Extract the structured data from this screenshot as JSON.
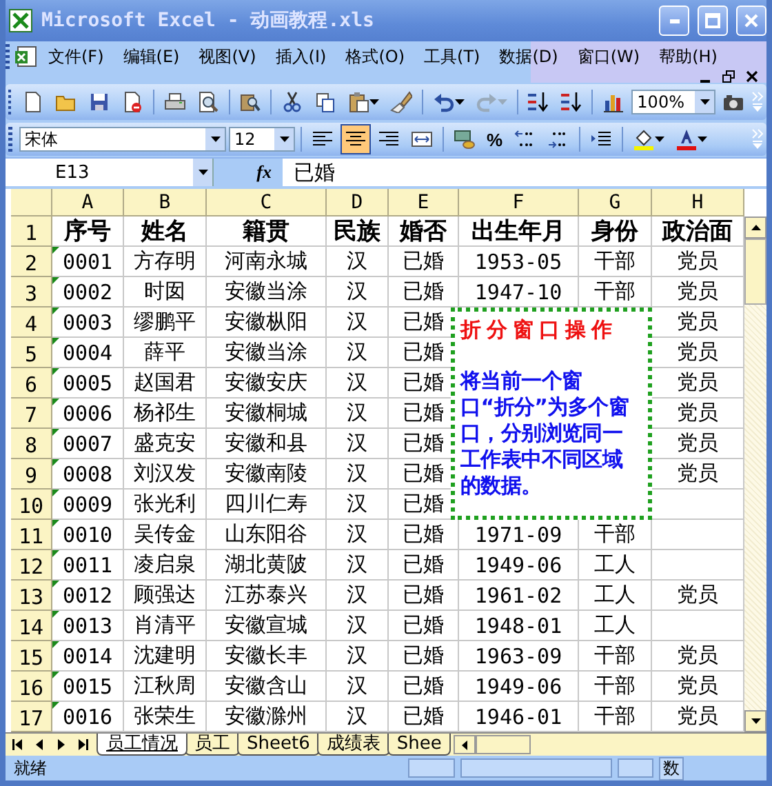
{
  "window": {
    "title": "Microsoft Excel - 动画教程.xls"
  },
  "menu": [
    "文件(F)",
    "编辑(E)",
    "视图(V)",
    "插入(I)",
    "格式(O)",
    "工具(T)",
    "数据(D)",
    "窗口(W)",
    "帮助(H)"
  ],
  "standard_toolbar": {
    "zoom": "100%"
  },
  "format_toolbar": {
    "font": "宋体",
    "size": "12",
    "percent": "%",
    "alignment": [
      {
        "kind": "left",
        "selected": false
      },
      {
        "kind": "center",
        "selected": true
      },
      {
        "kind": "right",
        "selected": false
      }
    ]
  },
  "formula_bar": {
    "name_box": "E13",
    "fx": "fx",
    "value": "已婚"
  },
  "sheet": {
    "columns": [
      "A",
      "B",
      "C",
      "D",
      "E",
      "F",
      "G",
      "H"
    ],
    "rows": [
      {
        "number": "1",
        "kind": "heading",
        "flagged": false,
        "cells": [
          "序号",
          "姓名",
          "籍贯",
          "民族",
          "婚否",
          "出生年月",
          "身份",
          "政治面"
        ]
      },
      {
        "number": "2",
        "kind": "data",
        "flagged": true,
        "cells": [
          "0001",
          "方存明",
          "河南永城",
          "汉",
          "已婚",
          "1953-05",
          "干部",
          "党员"
        ]
      },
      {
        "number": "3",
        "kind": "data",
        "flagged": true,
        "cells": [
          "0002",
          "时囡",
          "安徽当涂",
          "汉",
          "已婚",
          "1947-10",
          "干部",
          "党员"
        ]
      },
      {
        "number": "4",
        "kind": "data",
        "flagged": true,
        "cells": [
          "0003",
          "缪鹏平",
          "安徽枞阳",
          "汉",
          "已婚",
          null,
          null,
          "党员"
        ]
      },
      {
        "number": "5",
        "kind": "data",
        "flagged": true,
        "cells": [
          "0004",
          "薛平",
          "安徽当涂",
          "汉",
          "已婚",
          null,
          null,
          "党员"
        ]
      },
      {
        "number": "6",
        "kind": "data",
        "flagged": true,
        "cells": [
          "0005",
          "赵国君",
          "安徽安庆",
          "汉",
          "已婚",
          null,
          null,
          "党员"
        ]
      },
      {
        "number": "7",
        "kind": "data",
        "flagged": true,
        "cells": [
          "0006",
          "杨祁生",
          "安徽桐城",
          "汉",
          "已婚",
          null,
          null,
          "党员"
        ]
      },
      {
        "number": "8",
        "kind": "data",
        "flagged": true,
        "cells": [
          "0007",
          "盛克安",
          "安徽和县",
          "汉",
          "已婚",
          null,
          null,
          "党员"
        ]
      },
      {
        "number": "9",
        "kind": "data",
        "flagged": true,
        "cells": [
          "0008",
          "刘汉发",
          "安徽南陵",
          "汉",
          "已婚",
          null,
          null,
          "党员"
        ]
      },
      {
        "number": "10",
        "kind": "data",
        "flagged": true,
        "cells": [
          "0009",
          "张光利",
          "四川仁寿",
          "汉",
          "已婚",
          null,
          null,
          null
        ]
      },
      {
        "number": "11",
        "kind": "data",
        "flagged": true,
        "cells": [
          "0010",
          "吴传金",
          "山东阳谷",
          "汉",
          "已婚",
          "1971-09",
          "干部",
          null
        ]
      },
      {
        "number": "12",
        "kind": "data",
        "flagged": true,
        "cells": [
          "0011",
          "凌启泉",
          "湖北黄陂",
          "汉",
          "已婚",
          "1949-06",
          "工人",
          null
        ]
      },
      {
        "number": "13",
        "kind": "data",
        "flagged": true,
        "cells": [
          "0012",
          "顾强达",
          "江苏泰兴",
          "汉",
          "已婚",
          "1961-02",
          "工人",
          "党员"
        ]
      },
      {
        "number": "14",
        "kind": "data",
        "flagged": true,
        "cells": [
          "0013",
          "肖清平",
          "安徽宣城",
          "汉",
          "已婚",
          "1948-01",
          "工人",
          null
        ]
      },
      {
        "number": "15",
        "kind": "data",
        "flagged": true,
        "cells": [
          "0014",
          "沈建明",
          "安徽长丰",
          "汉",
          "已婚",
          "1963-09",
          "干部",
          "党员"
        ]
      },
      {
        "number": "16",
        "kind": "data",
        "flagged": true,
        "cells": [
          "0015",
          "江秋周",
          "安徽含山",
          "汉",
          "已婚",
          "1949-06",
          "干部",
          "党员"
        ]
      },
      {
        "number": "17",
        "kind": "data",
        "flagged": true,
        "cells": [
          "0016",
          "张荣生",
          "安徽滁州",
          "汉",
          "已婚",
          "1946-01",
          "干部",
          "党员"
        ]
      }
    ]
  },
  "callout": {
    "title": "折分窗口操作",
    "body": "将当前一个窗口“折分”为多个窗口，分别浏览同一工作表中不同区域的数据。"
  },
  "sheet_tabs": [
    {
      "label": "员工情况",
      "selected": true
    },
    {
      "label": "员工",
      "selected": false
    },
    {
      "label": "Sheet6",
      "selected": false
    },
    {
      "label": "成绩表",
      "selected": false
    },
    {
      "label": "Shee",
      "selected": false
    }
  ],
  "status_bar": {
    "state": "就绪",
    "indicator": "数"
  }
}
